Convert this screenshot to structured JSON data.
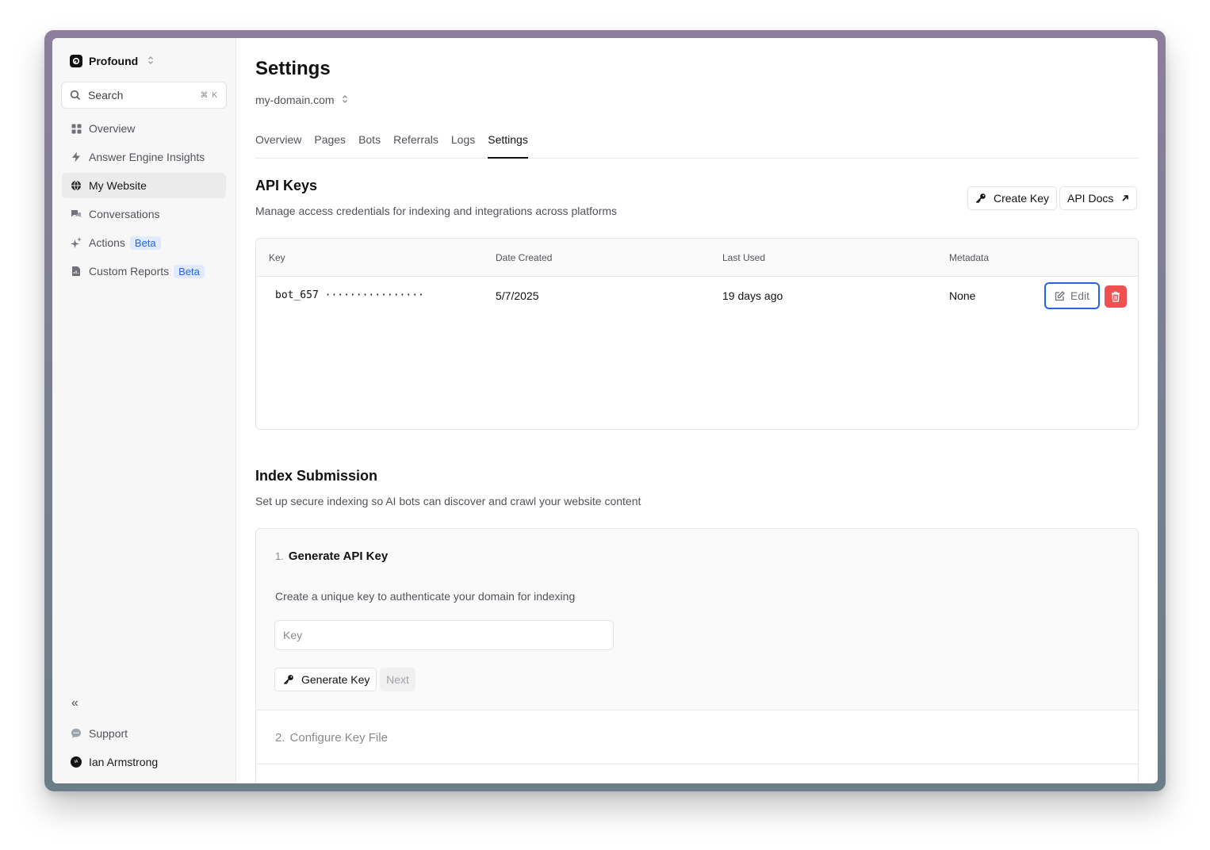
{
  "sidebar": {
    "brand": "Profound",
    "search": {
      "label": "Search",
      "shortcut": "⌘ K"
    },
    "items": [
      {
        "label": "Overview",
        "icon": "grid-icon",
        "active": false
      },
      {
        "label": "Answer Engine Insights",
        "icon": "lightning-icon",
        "active": false
      },
      {
        "label": "My Website",
        "icon": "globe-icon",
        "active": true
      },
      {
        "label": "Conversations",
        "icon": "chat-icon",
        "active": false
      },
      {
        "label": "Actions",
        "icon": "sparkle-icon",
        "active": false,
        "badge": "Beta"
      },
      {
        "label": "Custom Reports",
        "icon": "report-icon",
        "active": false,
        "badge": "Beta"
      }
    ],
    "collapse_icon": "«",
    "support": "Support",
    "user": {
      "name": "Ian Armstrong",
      "initials": "IA"
    }
  },
  "header": {
    "title": "Settings",
    "domain": "my-domain.com"
  },
  "tabs": [
    "Overview",
    "Pages",
    "Bots",
    "Referrals",
    "Logs",
    "Settings"
  ],
  "active_tab": "Settings",
  "api_keys": {
    "title": "API Keys",
    "description": "Manage access credentials for indexing and integrations across platforms",
    "create_label": "Create Key",
    "docs_label": "API Docs",
    "columns": [
      "Key",
      "Date Created",
      "Last Used",
      "Metadata"
    ],
    "rows": [
      {
        "key": "bot_657",
        "masked": "················",
        "date_created": "5/7/2025",
        "last_used": "19 days ago",
        "metadata": "None"
      }
    ],
    "edit_label": "Edit"
  },
  "index_submission": {
    "title": "Index Submission",
    "description": "Set up secure indexing so AI bots can discover and crawl your website content",
    "step1": {
      "number": "1.",
      "title": "Generate API Key",
      "description": "Create a unique key to authenticate your domain for indexing",
      "input_placeholder": "Key",
      "input_value": "",
      "generate_label": "Generate Key",
      "next_label": "Next"
    },
    "step2": {
      "number": "2.",
      "title": "Configure Key File"
    }
  },
  "colors": {
    "accent": "#2563eb",
    "danger": "#ef5050",
    "badge_bg": "#e0ebff"
  }
}
